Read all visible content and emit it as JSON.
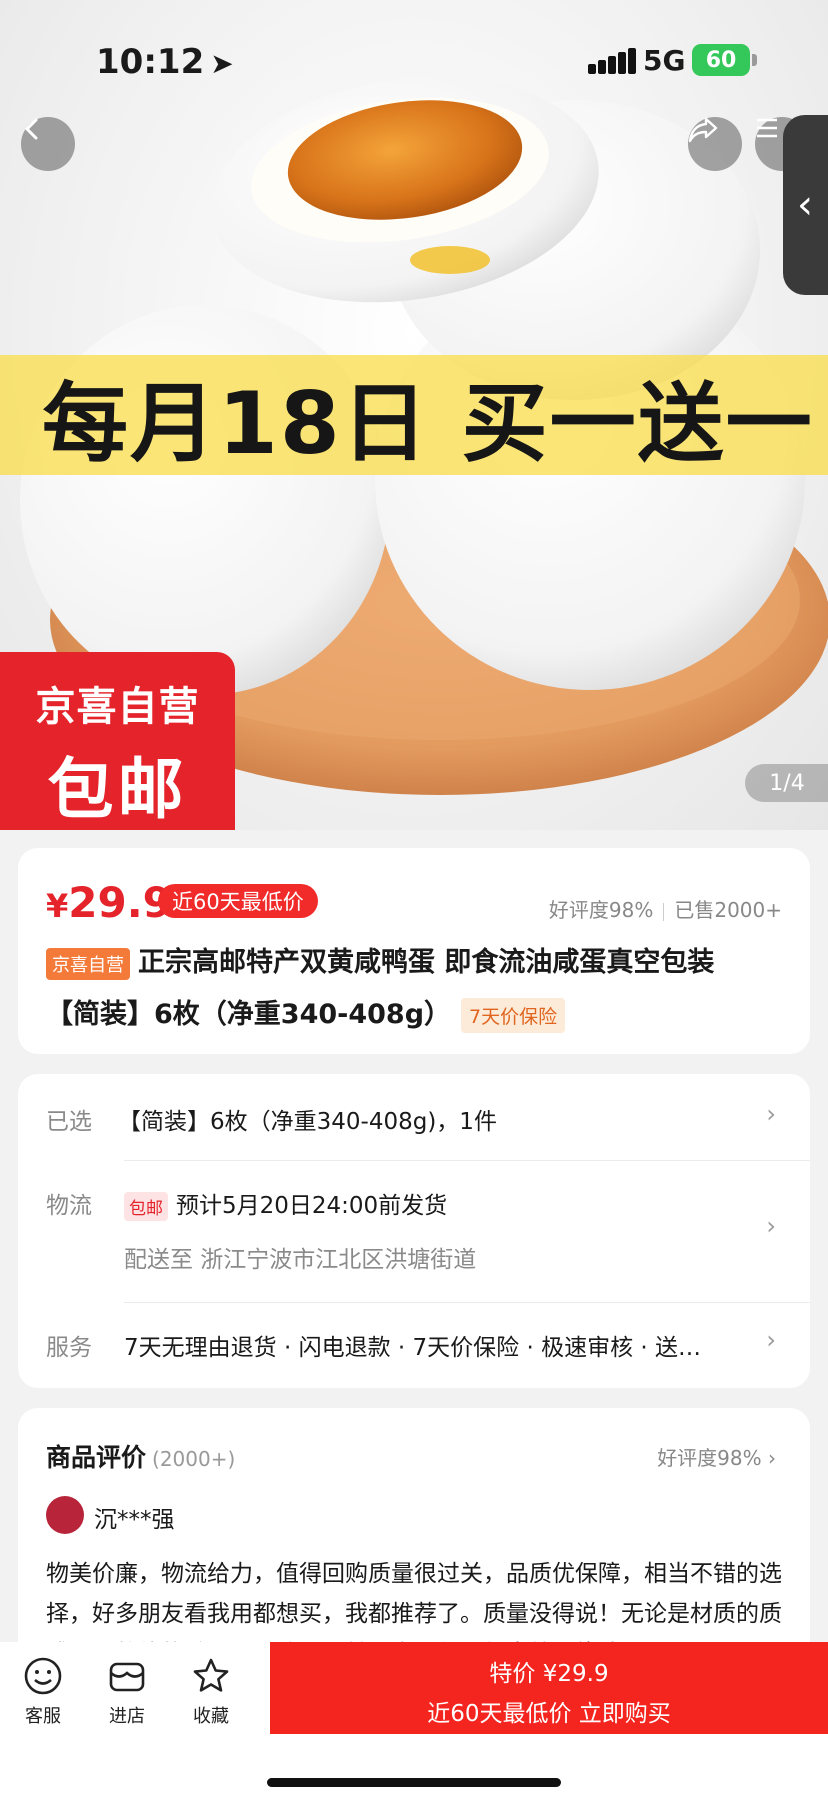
{
  "status": {
    "time": "10:12",
    "network": "5G",
    "battery": "60"
  },
  "hero": {
    "banner": "每月18日 买一送一",
    "badge_line1": "京喜自营",
    "badge_line2": "包邮",
    "pager": "1/4"
  },
  "price": {
    "symbol": "¥",
    "value": "29.9",
    "low_tag": "近60天最低价",
    "rating": "好评度98%",
    "sold": "已售2000+"
  },
  "product": {
    "store_tag": "京喜自营",
    "title_line1": "正宗高邮特产双黄咸鸭蛋 即食流油咸蛋真空包装",
    "title_line2": "【简装】6枚（净重340-408g）",
    "protect_tag": "7天价保险"
  },
  "spec": {
    "selected_label": "已选",
    "selected_value": "【简装】6枚（净重340-408g)，1件",
    "logistics_label": "物流",
    "ship_tag": "包邮",
    "ship_time": "预计5月20日24:00前发货",
    "ship_to": "配送至 浙江宁波市江北区洪塘街道",
    "service_label": "服务",
    "service_value": "7天无理由退货 · 闪电退款 · 7天价保险 · 极速审核 · 送…"
  },
  "review": {
    "title": "商品评价",
    "count": "(2000+)",
    "rate": "好评度98%",
    "user": "沉***强",
    "body": "物美价廉，物流给力，值得回购质量很过关，品质优保障，相当不错的选择，好多朋友看我用都想买，我都推荐了。质量没得说！无论是材质的质感还是整体的做工，都让人眼前一亮。使用起来效果绝佳"
  },
  "bottom": {
    "service": "客服",
    "shop": "进店",
    "favorite": "收藏",
    "buy_line1": "特价 ¥29.9",
    "buy_line2": "近60天最低价 立即购买"
  },
  "colors": {
    "accent": "#e4232b",
    "buy": "#f4241f",
    "banner": "#f8de50"
  }
}
